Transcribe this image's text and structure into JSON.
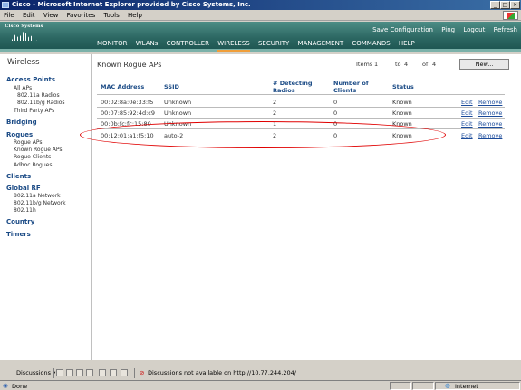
{
  "window": {
    "title": "Cisco - Microsoft Internet Explorer provided by Cisco Systems, Inc.",
    "controls": {
      "minimize": "_",
      "maximize": "□",
      "close": "×"
    }
  },
  "menubar": [
    "File",
    "Edit",
    "View",
    "Favorites",
    "Tools",
    "Help"
  ],
  "cisco": {
    "logo_text": "Cisco Systems",
    "top_links": [
      "Save Configuration",
      "Ping",
      "Logout",
      "Refresh"
    ],
    "tabs": [
      "MONITOR",
      "WLANs",
      "CONTROLLER",
      "WIRELESS",
      "SECURITY",
      "MANAGEMENT",
      "COMMANDS",
      "HELP"
    ],
    "active_tab": "WIRELESS",
    "accent": "#f09e3a",
    "header_color": "#2c6762"
  },
  "sidebar": {
    "heading": "Wireless",
    "access_points": "Access Points",
    "ap_items": [
      "All APs",
      "802.11a Radios",
      "802.11b/g Radios",
      "Third Party APs"
    ],
    "bridging": "Bridging",
    "rogues": "Rogues",
    "rogue_items": [
      "Rogue APs",
      "Known Rogue APs",
      "Rogue Clients",
      "Adhoc Rogues"
    ],
    "clients": "Clients",
    "global_rf": "Global RF",
    "rf_items": [
      "802.11a Network",
      "802.11b/g Network",
      "802.11h"
    ],
    "country": "Country",
    "timers": "Timers"
  },
  "main": {
    "title": "Known Rogue APs",
    "items_label": "Items",
    "items_from": "1",
    "items_to_label": "to",
    "items_to": "4",
    "items_of_label": "of",
    "items_total": "4",
    "new_button": "New...",
    "columns": [
      "MAC Address",
      "SSID",
      "# Detecting Radios",
      "Number of Clients",
      "Status"
    ],
    "detecting_l1": "# Detecting",
    "detecting_l2": "Radios",
    "clients_l1": "Number of",
    "clients_l2": "Clients",
    "rows": [
      {
        "mac": "00:02:8a:0e:33:f5",
        "ssid": "Unknown",
        "radios": "2",
        "clients": "0",
        "status": "Known",
        "edit": "Edit",
        "remove": "Remove"
      },
      {
        "mac": "00:07:85:92:4d:c9",
        "ssid": "Unknown",
        "radios": "2",
        "clients": "0",
        "status": "Known",
        "edit": "Edit",
        "remove": "Remove"
      },
      {
        "mac": "00:0b:fc:fc:15:80",
        "ssid": "Unknown",
        "radios": "1",
        "clients": "0",
        "status": "Known",
        "edit": "Edit",
        "remove": "Remove"
      },
      {
        "mac": "00:12:01:a1:f5:10",
        "ssid": "auto-2",
        "radios": "2",
        "clients": "0",
        "status": "Known",
        "edit": "Edit",
        "remove": "Remove"
      }
    ],
    "highlight_color": "#e00000"
  },
  "discussions_bar": {
    "label": "Discussions ▾",
    "message": "Discussions not available on http://10.77.244.204/"
  },
  "statusbar": {
    "status": "Done",
    "zone": "Internet"
  }
}
